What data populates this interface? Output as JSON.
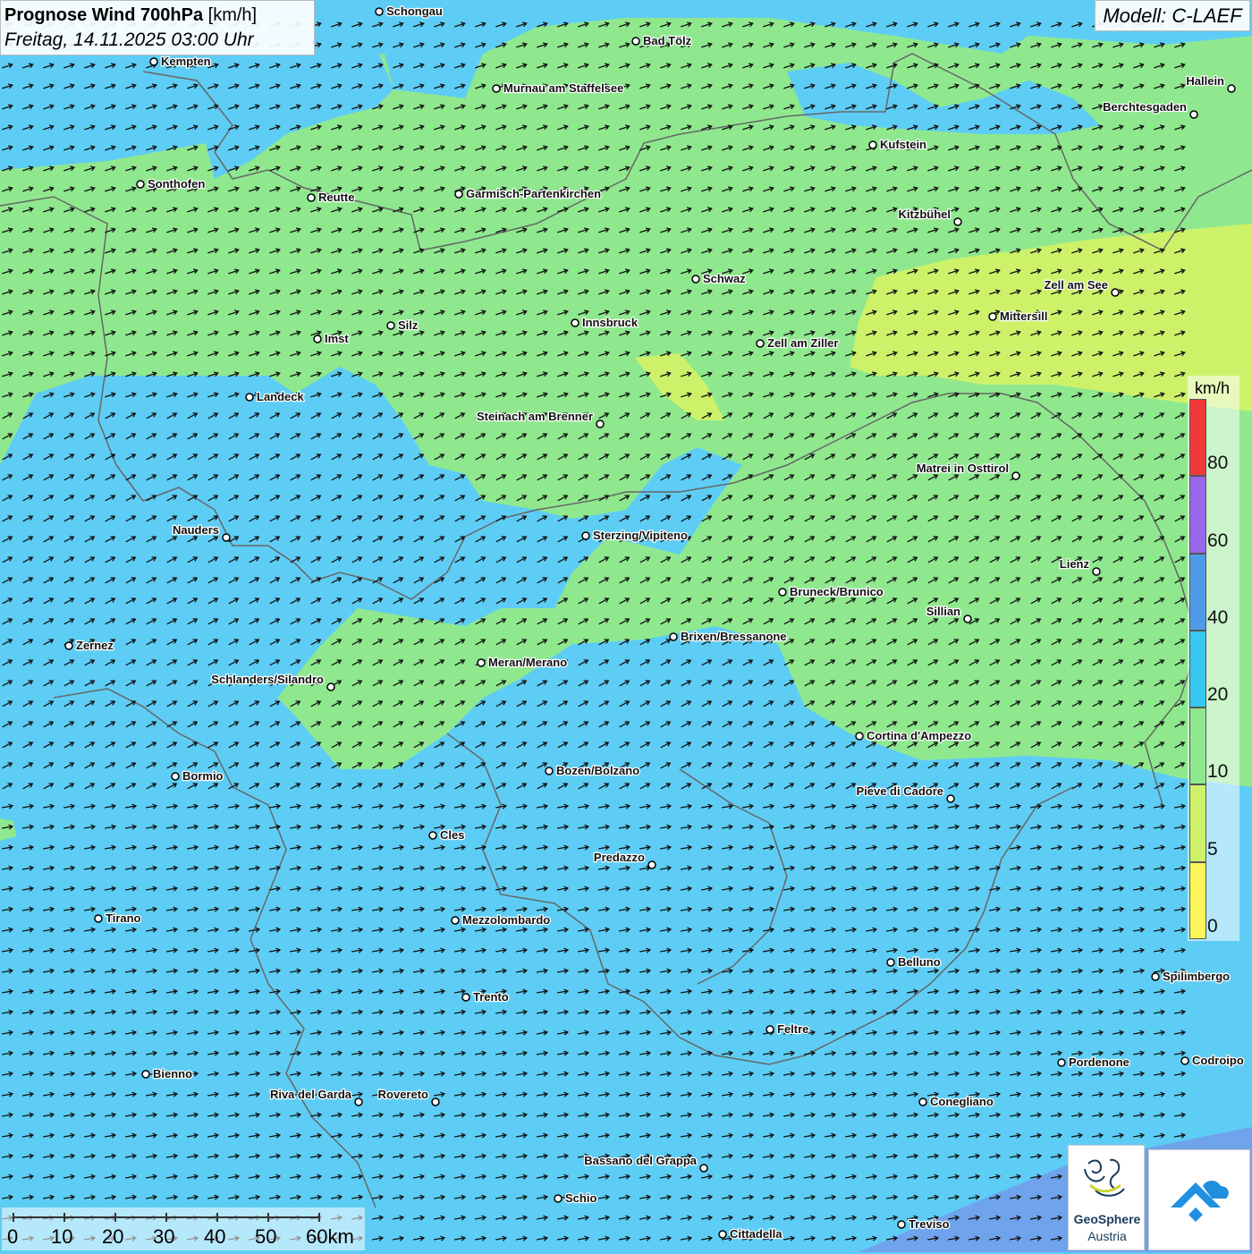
{
  "title": {
    "main": "Prognose Wind 700hPa",
    "unit": "[km/h]",
    "datetime": "Freitag, 14.11.2025 03:00 Uhr"
  },
  "model": "Modell: C-LAEF",
  "legend": {
    "unit": "km/h",
    "levels": [
      {
        "label": "0",
        "value": 0,
        "color": "#fcf65a"
      },
      {
        "label": "5",
        "value": 5,
        "color": "#cdf26a"
      },
      {
        "label": "10",
        "value": 10,
        "color": "#8fe88e"
      },
      {
        "label": "20",
        "value": 20,
        "color": "#38c8f2"
      },
      {
        "label": "40",
        "value": 40,
        "color": "#4e9bea"
      },
      {
        "label": "60",
        "value": 60,
        "color": "#9a66ea"
      },
      {
        "label": "80",
        "value": 80,
        "color": "#f03a3a"
      }
    ]
  },
  "cities": [
    {
      "name": "Schongau"
    },
    {
      "name": "Bad Tölz"
    },
    {
      "name": "Kempten"
    },
    {
      "name": "Murnau am Staffelsee"
    },
    {
      "name": "Hallein"
    },
    {
      "name": "Berchtesgaden"
    },
    {
      "name": "Kufstein"
    },
    {
      "name": "Sonthofen"
    },
    {
      "name": "Reutte"
    },
    {
      "name": "Garmisch-Partenkirchen"
    },
    {
      "name": "Kitzbühel"
    },
    {
      "name": "Schwaz"
    },
    {
      "name": "Zell am See"
    },
    {
      "name": "Mittersill"
    },
    {
      "name": "Innsbruck"
    },
    {
      "name": "Silz"
    },
    {
      "name": "Imst"
    },
    {
      "name": "Zell am Ziller"
    },
    {
      "name": "Landeck"
    },
    {
      "name": "Steinach am Brenner"
    },
    {
      "name": "Matrei in Osttirol"
    },
    {
      "name": "Nauders"
    },
    {
      "name": "Sterzing/Vipiteno"
    },
    {
      "name": "Lienz"
    },
    {
      "name": "Bruneck/Brunico"
    },
    {
      "name": "Sillian"
    },
    {
      "name": "Zernez"
    },
    {
      "name": "Brixen/Bressanone"
    },
    {
      "name": "Meran/Merano"
    },
    {
      "name": "Schlanders/Silandro"
    },
    {
      "name": "Cortina d'Ampezzo"
    },
    {
      "name": "Bozen/Bolzano"
    },
    {
      "name": "Bormio"
    },
    {
      "name": "Pieve di Cadore"
    },
    {
      "name": "Cles"
    },
    {
      "name": "Predazzo"
    },
    {
      "name": "Tirano"
    },
    {
      "name": "Mezzolombardo"
    },
    {
      "name": "Belluno"
    },
    {
      "name": "Spilimbergo"
    },
    {
      "name": "Trento"
    },
    {
      "name": "Feltre"
    },
    {
      "name": "Bienno"
    },
    {
      "name": "Pordenone"
    },
    {
      "name": "Codroipo"
    },
    {
      "name": "Riva del Garda"
    },
    {
      "name": "Rovereto"
    },
    {
      "name": "Conegliano"
    },
    {
      "name": "Bassano del Grappa"
    },
    {
      "name": "Schio"
    },
    {
      "name": "Treviso"
    },
    {
      "name": "Cittadella"
    }
  ],
  "scale": {
    "labels": [
      "0",
      "10",
      "20",
      "30",
      "40",
      "50",
      "60km"
    ]
  },
  "logo": {
    "name": "GeoSphere",
    "sub": "Austria"
  },
  "colors": {
    "wind_0_5": "#fcf65a",
    "wind_5_10": "#cdf26a",
    "wind_10_20": "#8fe88e",
    "wind_20_40": "#5ecdf5",
    "wind_40_60": "#4e9bea",
    "arrow": "#111111",
    "border": "#666666"
  }
}
